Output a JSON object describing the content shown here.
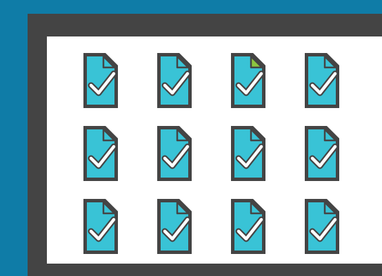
{
  "colors": {
    "background": "#0f7ca7",
    "frame": "#444444",
    "panel": "#ffffff",
    "doc_fill": "#39c3d6",
    "doc_border": "#444444",
    "check": "#ffffff",
    "highlight_fold": "#8dc63f"
  },
  "documents": [
    {
      "icon": "document-check-icon",
      "highlighted": false
    },
    {
      "icon": "document-check-icon",
      "highlighted": false
    },
    {
      "icon": "document-check-icon",
      "highlighted": true
    },
    {
      "icon": "document-check-icon",
      "highlighted": false
    },
    {
      "icon": "document-check-icon",
      "highlighted": false
    },
    {
      "icon": "document-check-icon",
      "highlighted": false
    },
    {
      "icon": "document-check-icon",
      "highlighted": false
    },
    {
      "icon": "document-check-icon",
      "highlighted": false
    },
    {
      "icon": "document-check-icon",
      "highlighted": false
    },
    {
      "icon": "document-check-icon",
      "highlighted": false
    },
    {
      "icon": "document-check-icon",
      "highlighted": false
    },
    {
      "icon": "document-check-icon",
      "highlighted": false
    }
  ]
}
